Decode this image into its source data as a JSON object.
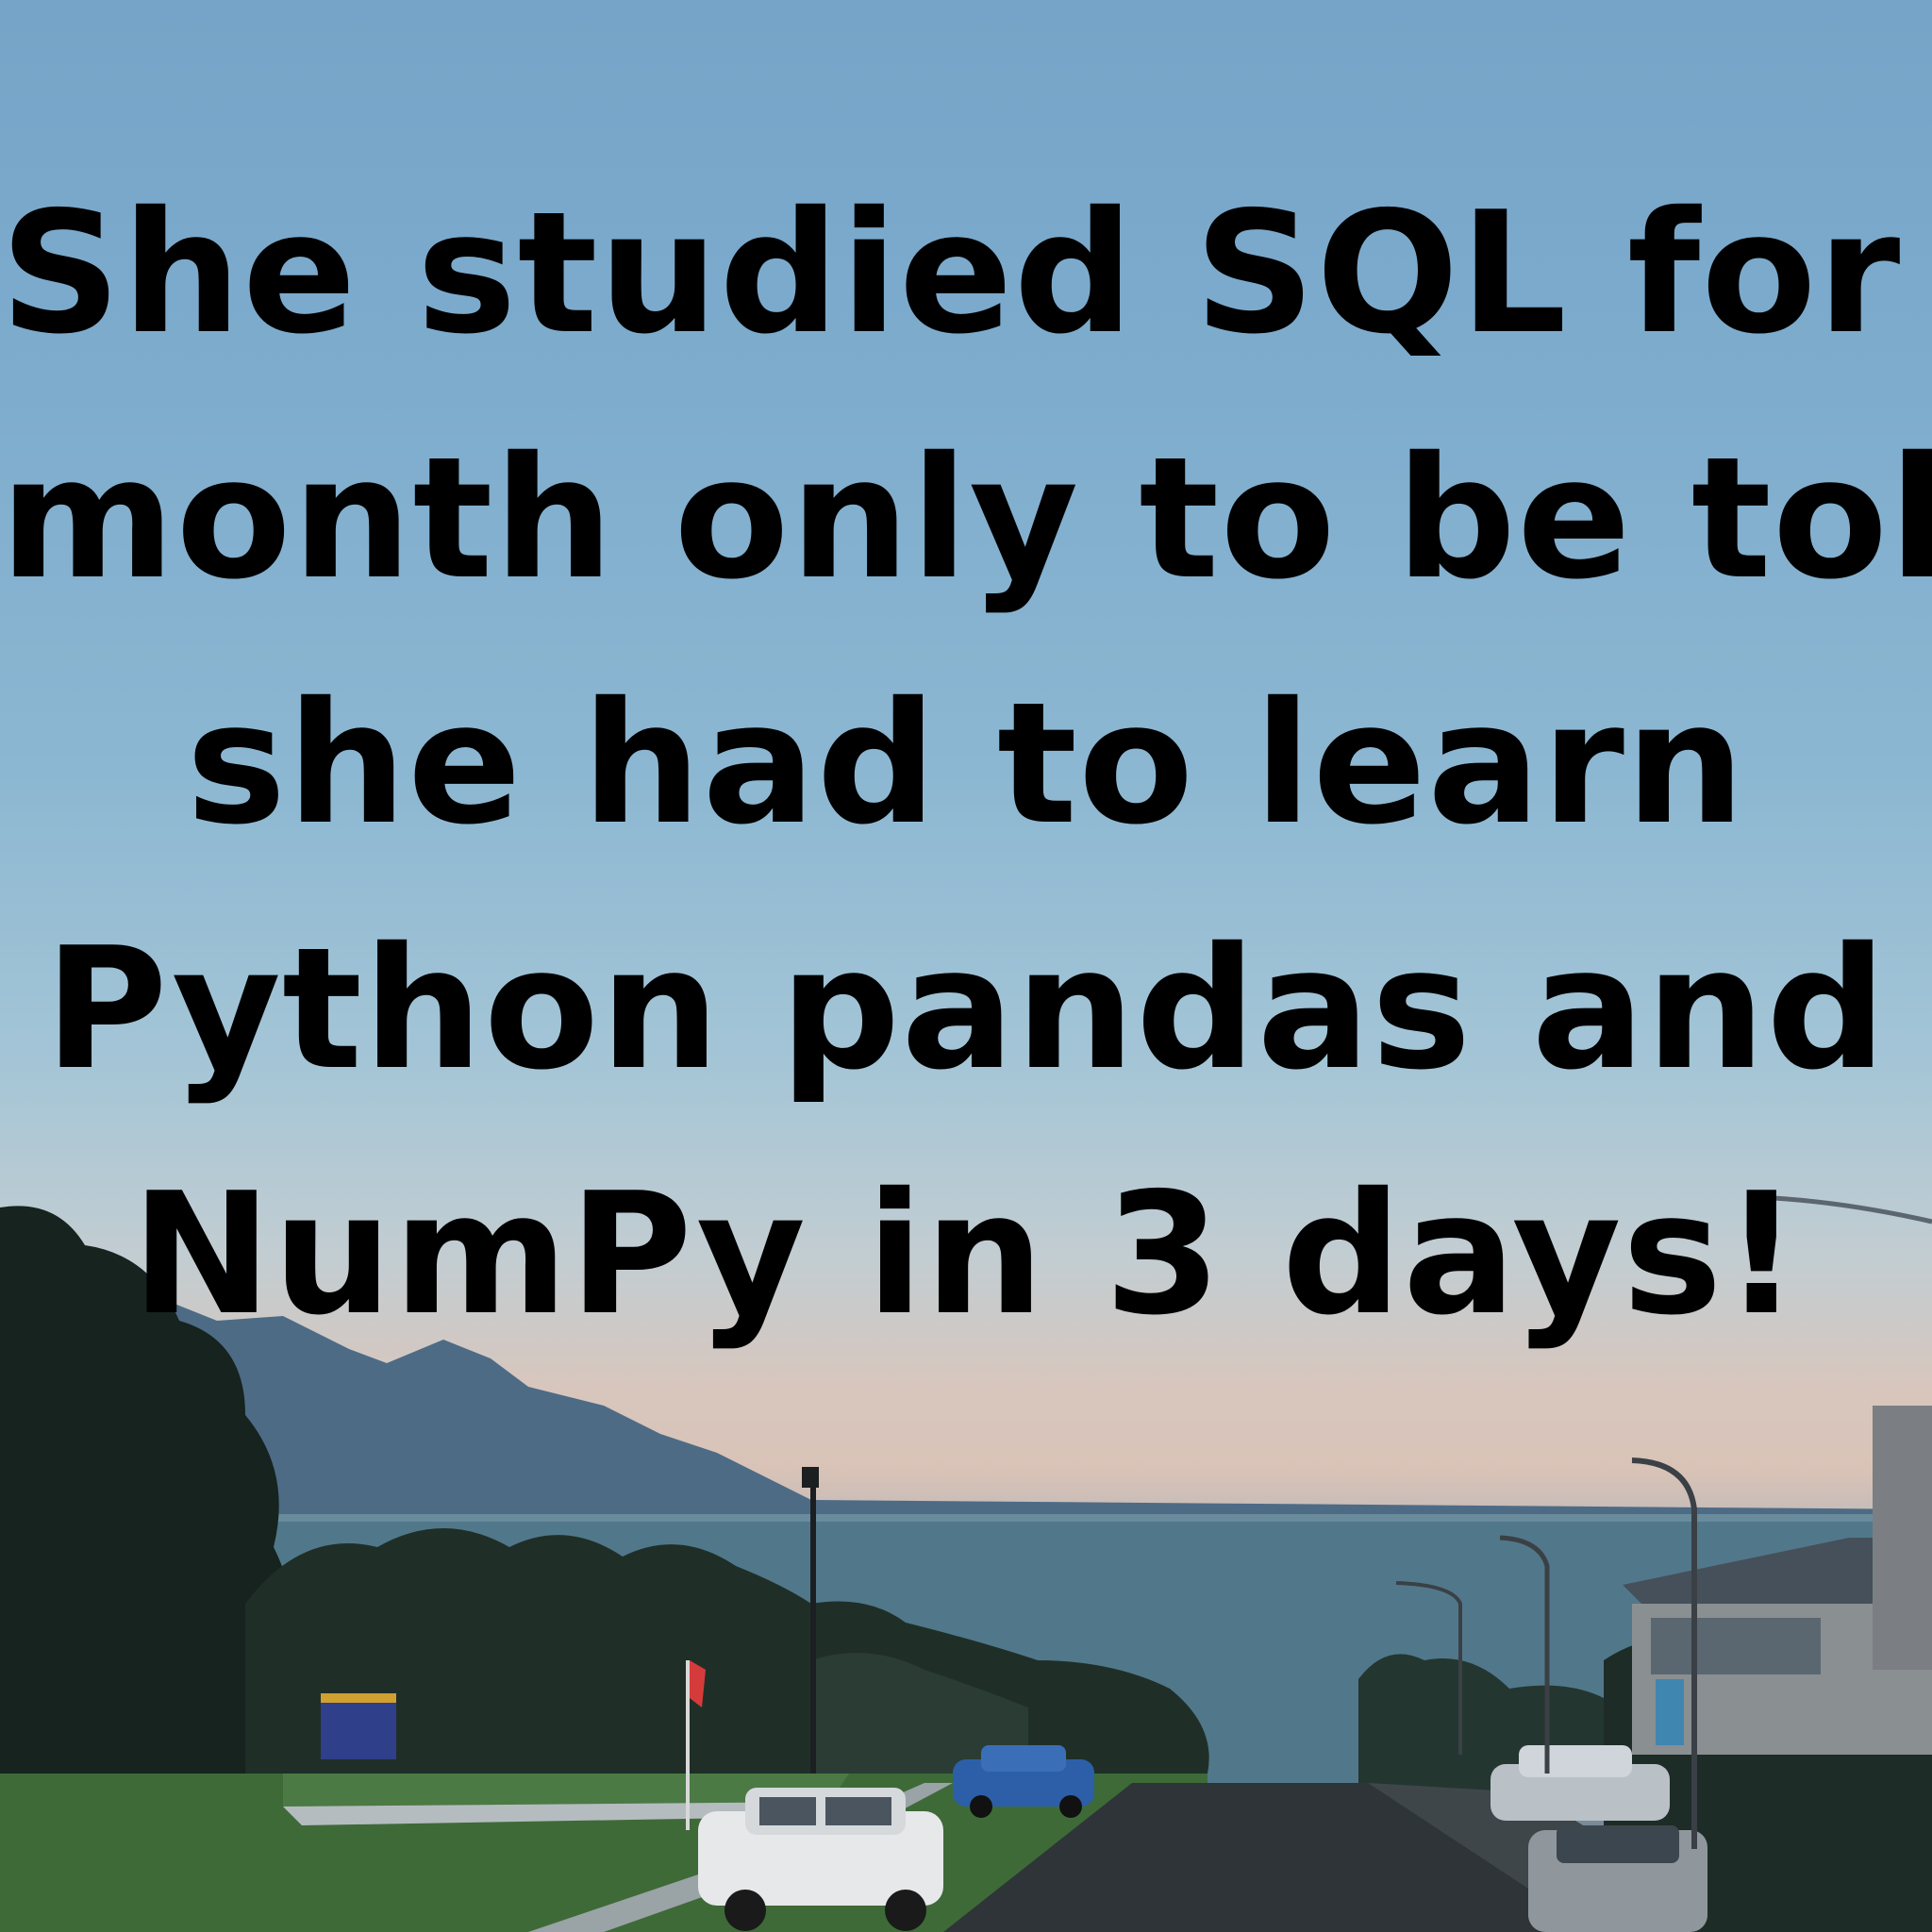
{
  "caption": {
    "lines": [
      "She studied SQL for a",
      "month only to be told",
      "she had to learn",
      "Python pandas and",
      "NumPy in 3 days!"
    ]
  },
  "colors": {
    "sky_top": "#76a4c8",
    "sky_horizon": "#d9c3b7",
    "sea": "#51788a",
    "foliage": "#1c2a25",
    "text": "#000000"
  }
}
